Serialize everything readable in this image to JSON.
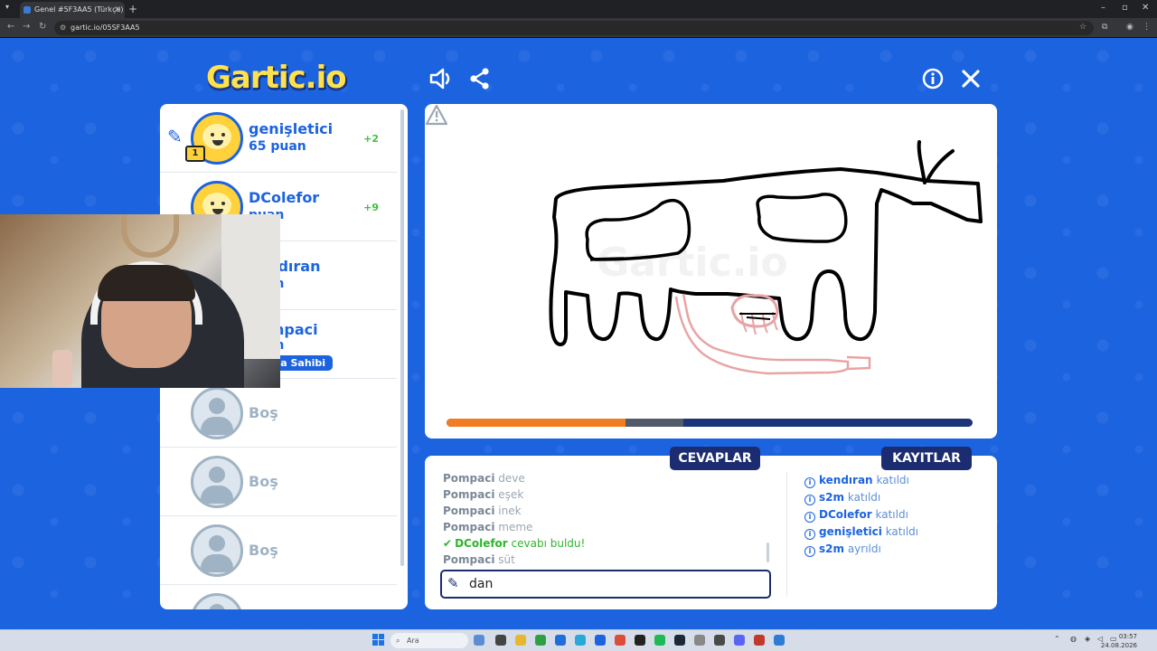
{
  "browser": {
    "tab_title": "Genel #5F3AA5 (Türkçe) - Gartic.io",
    "url": "gartic.io/05SF3AA5"
  },
  "game": {
    "logo": "Gartic.io",
    "players": [
      {
        "name": "genişletici",
        "points": "65 puan",
        "delta": "+2",
        "drawing": true
      },
      {
        "name": "DColefor",
        "points": "puan",
        "delta": "+9"
      },
      {
        "name": "kendıran",
        "points": "puan",
        "delta": ""
      },
      {
        "name": "Pompaci",
        "points": "puan",
        "delta": "",
        "badge": "Oda Sahibi"
      },
      {
        "name": "Boş"
      },
      {
        "name": "Boş"
      },
      {
        "name": "Boş"
      }
    ],
    "tabs": {
      "answers": "CEVAPLAR",
      "logs": "KAYITLAR"
    },
    "timer_fraction": 0.34,
    "chat": [
      {
        "who": "Pompaci",
        "what": "deve"
      },
      {
        "who": "Pompaci",
        "what": "eşek"
      },
      {
        "who": "Pompaci",
        "what": "inek"
      },
      {
        "who": "Pompaci",
        "what": "meme"
      },
      {
        "who": "DColefor",
        "what": "cevabı buldu!",
        "success": true
      },
      {
        "who": "Pompaci",
        "what": "süt"
      }
    ],
    "input_value": "dan",
    "logs": [
      {
        "who": "kendıran",
        "what": "katıldı"
      },
      {
        "who": "s2m",
        "what": "katıldı"
      },
      {
        "who": "DColefor",
        "what": "katıldı"
      },
      {
        "who": "genişletici",
        "what": "katıldı"
      },
      {
        "who": "s2m",
        "what": "ayrıldı"
      }
    ],
    "colors": {
      "accent": "#1c63e0",
      "dark": "#1b2c70",
      "timer": "#f07d23",
      "success": "#2db52d"
    }
  },
  "taskbar": {
    "search_placeholder": "Ara",
    "time": "03:57",
    "date": "24.08.2026"
  }
}
